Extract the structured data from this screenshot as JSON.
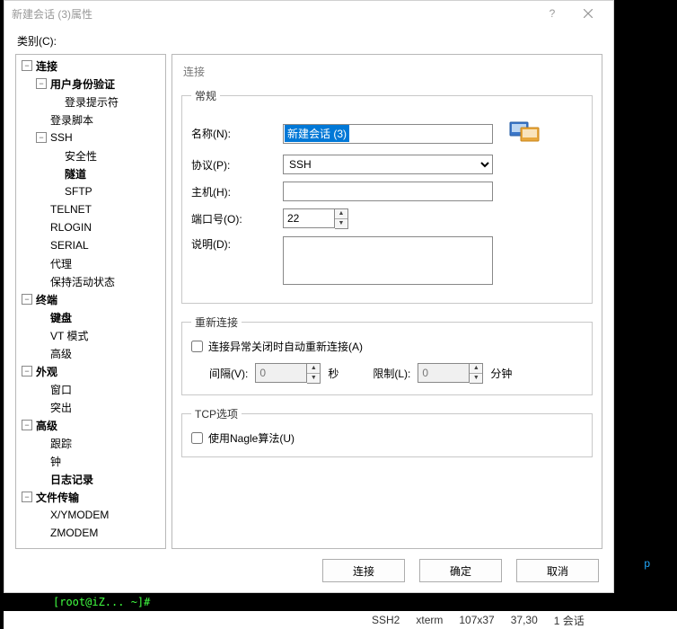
{
  "titlebar": {
    "title": "新建会话 (3)属性",
    "help": "?",
    "close": "×"
  },
  "category_label": "类别(C):",
  "tree": {
    "connection": "连接",
    "user_auth": "用户身份验证",
    "login_prompt": "登录提示符",
    "login_script": "登录脚本",
    "ssh": "SSH",
    "security": "安全性",
    "tunnel": "隧道",
    "sftp": "SFTP",
    "telnet": "TELNET",
    "rlogin": "RLOGIN",
    "serial": "SERIAL",
    "proxy": "代理",
    "keep_active": "保持活动状态",
    "terminal": "终端",
    "keyboard": "键盘",
    "vt_mode": "VT 模式",
    "advanced_t": "高级",
    "appearance": "外观",
    "window": "窗口",
    "highlight": "突出",
    "advanced": "高级",
    "trace": "跟踪",
    "bell": "钟",
    "logging": "日志记录",
    "file_transfer": "文件传输",
    "xymodem": "X/YMODEM",
    "zmodem": "ZMODEM"
  },
  "right": {
    "heading": "连接",
    "general_legend": "常规",
    "name_label": "名称(N):",
    "name_value": "新建会话 (3)",
    "proto_label": "协议(P):",
    "proto_value": "SSH",
    "host_label": "主机(H):",
    "host_value": "",
    "port_label": "端口号(O):",
    "port_value": "22",
    "desc_label": "说明(D):",
    "desc_value": "",
    "recon_legend": "重新连接",
    "recon_chk": "连接异常关闭时自动重新连接(A)",
    "interval_label": "间隔(V):",
    "interval_value": "0",
    "sec_unit": "秒",
    "limit_label": "限制(L):",
    "limit_value": "0",
    "min_unit": "分钟",
    "tcp_legend": "TCP选项",
    "nagle_chk": "使用Nagle算法(U)"
  },
  "buttons": {
    "connect": "连接",
    "ok": "确定",
    "cancel": "取消"
  },
  "status": {
    "ssh": "SSH2",
    "term": "xterm",
    "size": "107x37",
    "pos": "37,30",
    "sess": "1 会话"
  }
}
